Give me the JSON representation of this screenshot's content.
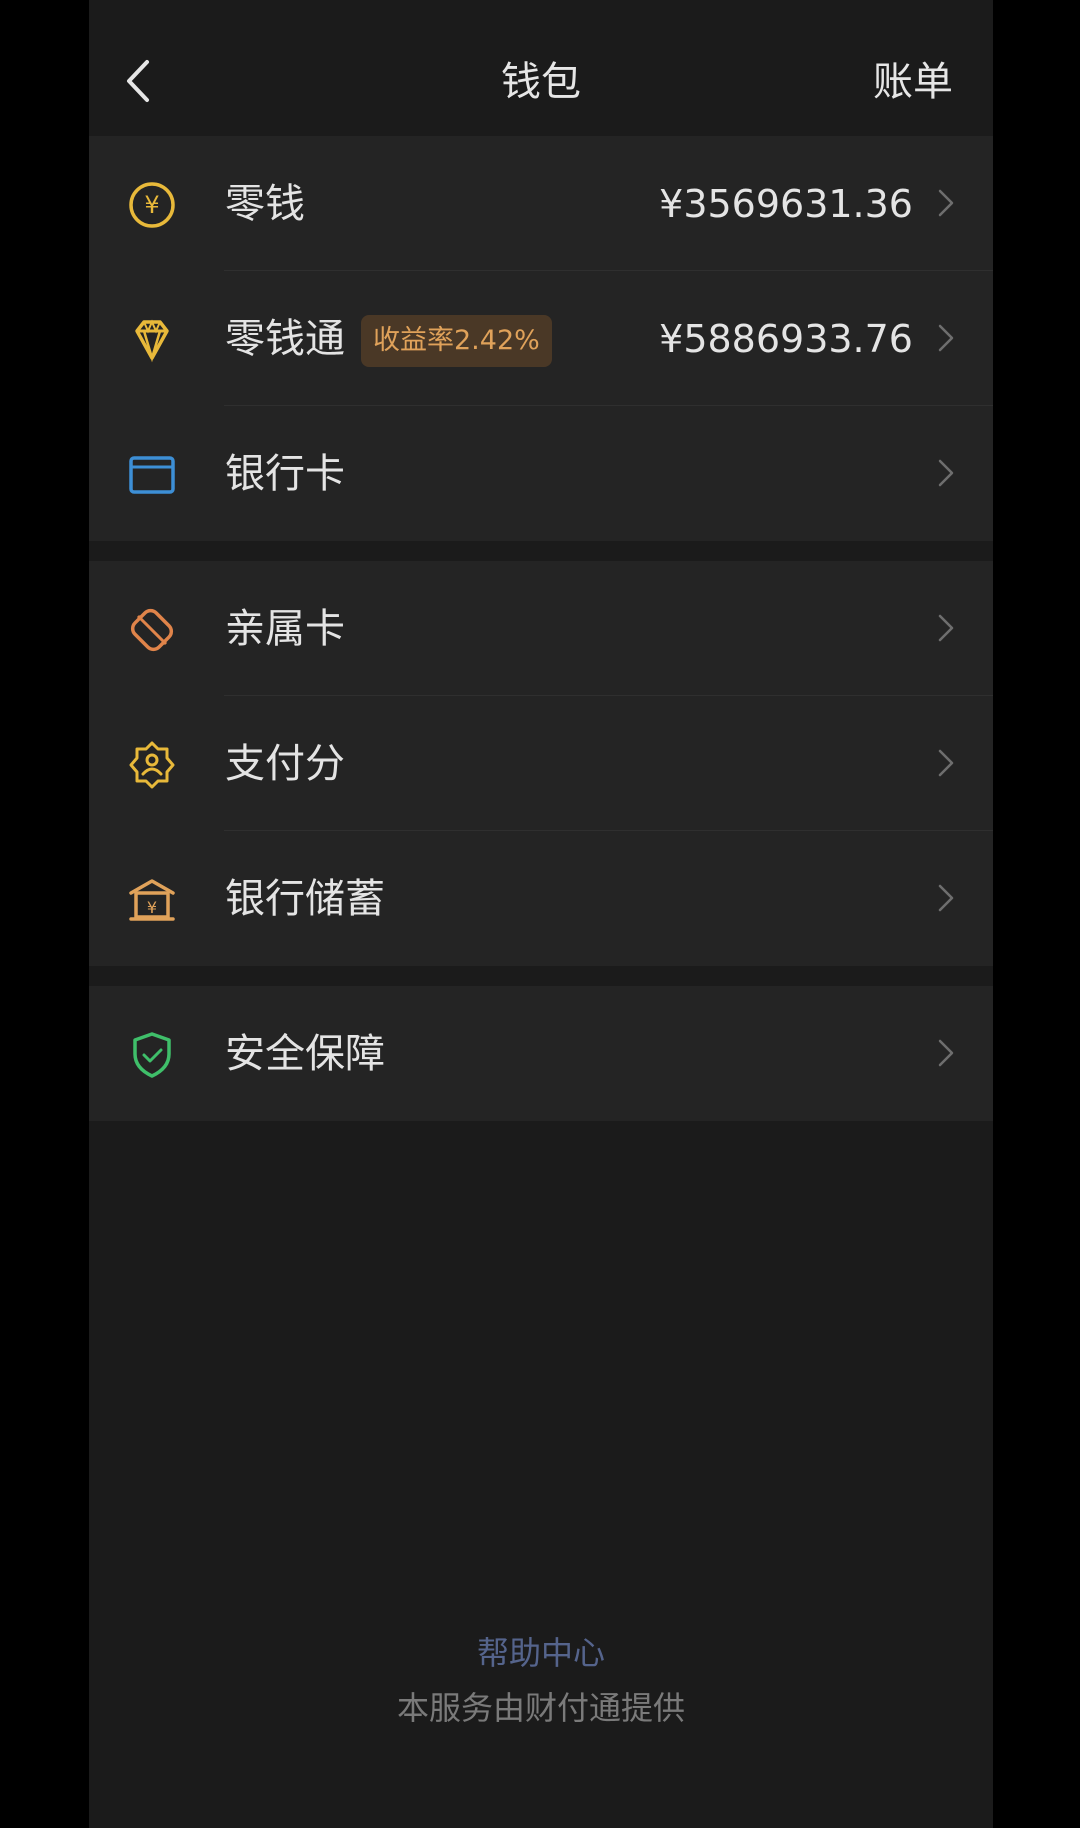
{
  "header": {
    "title": "钱包",
    "bill_label": "账单"
  },
  "groups": [
    {
      "items": [
        {
          "label": "零钱",
          "amount": "¥3569631.36",
          "icon": "yuan-coin-icon",
          "color": "#e8b93a"
        },
        {
          "label": "零钱通",
          "badge": "收益率2.42%",
          "amount": "¥5886933.76",
          "icon": "diamond-icon",
          "color": "#e8b93a"
        },
        {
          "label": "银行卡",
          "icon": "bank-card-icon",
          "color": "#3d8fd6"
        }
      ]
    },
    {
      "items": [
        {
          "label": "亲属卡",
          "icon": "family-card-icon",
          "color": "#e0844a"
        },
        {
          "label": "支付分",
          "icon": "pay-score-icon",
          "color": "#e8b93a"
        },
        {
          "label": "银行储蓄",
          "icon": "bank-savings-icon",
          "color": "#e0a25a"
        }
      ]
    },
    {
      "items": [
        {
          "label": "安全保障",
          "icon": "shield-icon",
          "color": "#3fbf6a"
        }
      ]
    }
  ],
  "footer": {
    "help": "帮助中心",
    "note": "本服务由财付通提供"
  }
}
